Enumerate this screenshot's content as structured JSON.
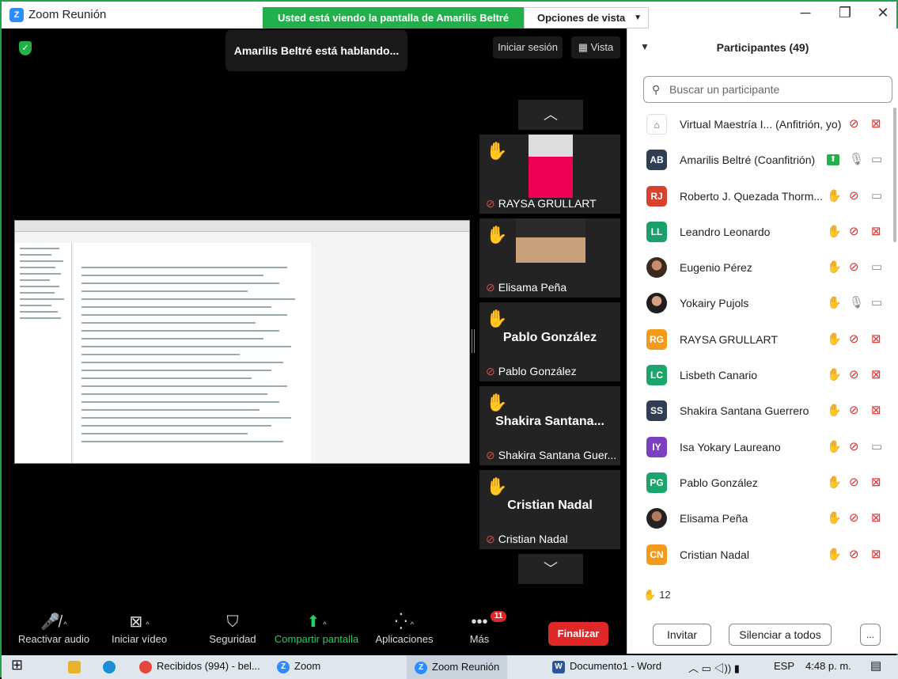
{
  "window": {
    "title": "Zoom Reunión",
    "share_banner": "Usted está viendo la pantalla de Amarilis Beltré",
    "view_options": "Opciones de vista"
  },
  "meeting": {
    "speaking_notice": "Amarilis Beltré está hablando...",
    "sign_in": "Iniciar sesión",
    "view": "Vista"
  },
  "videos": [
    {
      "name": "RAYSA GRULLART",
      "big": "",
      "has_photo": true
    },
    {
      "name": "Elisama Peña",
      "big": "",
      "has_photo": true
    },
    {
      "name": "Pablo González",
      "big": "Pablo González",
      "has_photo": false
    },
    {
      "name": "Shakira Santana Guer...",
      "big": "Shakira  Santana...",
      "has_photo": false
    },
    {
      "name": "Cristian Nadal",
      "big": "Cristian Nadal",
      "has_photo": false
    }
  ],
  "toolbar": {
    "unmute": "Reactivar audio",
    "start_video": "Iniciar vídeo",
    "security": "Seguridad",
    "share": "Compartir pantalla",
    "apps": "Aplicaciones",
    "more": "Más",
    "more_badge": "11",
    "end": "Finalizar"
  },
  "participants": {
    "title": "Participantes (49)",
    "search_placeholder": "Buscar un participante",
    "items": [
      {
        "initials": "",
        "name": "Virtual Maestría I... (Anfitrión, yo)",
        "color": "#ffffff",
        "hand": false,
        "mic_off": true,
        "cam_off": true
      },
      {
        "initials": "AB",
        "name": "Amarilis Beltré (Coanfitrión)",
        "color": "#2f3e52",
        "hand": false,
        "mic_off": false,
        "cam_off": false,
        "sharing": true
      },
      {
        "initials": "RJ",
        "name": "Roberto J. Quezada Thorm...",
        "color": "#d9432e",
        "hand": true,
        "mic_off": true,
        "cam_off": false
      },
      {
        "initials": "LL",
        "name": "Leandro Leonardo",
        "color": "#1aa06b",
        "hand": true,
        "mic_off": true,
        "cam_off": true
      },
      {
        "initials": "",
        "name": "Eugenio Pérez",
        "color": "#3a3a3a",
        "hand": true,
        "mic_off": true,
        "cam_off": false
      },
      {
        "initials": "",
        "name": "Yokairy Pujols",
        "color": "#3a3a3a",
        "hand": true,
        "mic_off": false,
        "cam_off": false
      },
      {
        "initials": "RG",
        "name": "RAYSA GRULLART",
        "color": "#f29a1b",
        "hand": true,
        "mic_off": true,
        "cam_off": true
      },
      {
        "initials": "LC",
        "name": "Lisbeth Canario",
        "color": "#1ba56b",
        "hand": true,
        "mic_off": true,
        "cam_off": true
      },
      {
        "initials": "SS",
        "name": "Shakira Santana Guerrero",
        "color": "#2f3e52",
        "hand": true,
        "mic_off": true,
        "cam_off": true
      },
      {
        "initials": "IY",
        "name": "Isa Yokary Laureano",
        "color": "#7b3fbf",
        "hand": true,
        "mic_off": true,
        "cam_off": false
      },
      {
        "initials": "PG",
        "name": "Pablo González",
        "color": "#1ba56b",
        "hand": true,
        "mic_off": true,
        "cam_off": true
      },
      {
        "initials": "",
        "name": "Elisama Peña",
        "color": "#3a3a3a",
        "hand": true,
        "mic_off": true,
        "cam_off": true
      },
      {
        "initials": "CN",
        "name": "Cristian Nadal",
        "color": "#f29a1b",
        "hand": true,
        "mic_off": true,
        "cam_off": true
      }
    ],
    "raised_hands": "12",
    "invite": "Invitar",
    "mute_all": "Silenciar a todos",
    "more": "..."
  },
  "taskbar": {
    "gmail": "Recibidos (994) - bel...",
    "zoom": "Zoom",
    "zoom_meeting": "Zoom Reunión",
    "word": "Documento1 - Word",
    "lang": "ESP",
    "time": "4:48 p. m."
  }
}
